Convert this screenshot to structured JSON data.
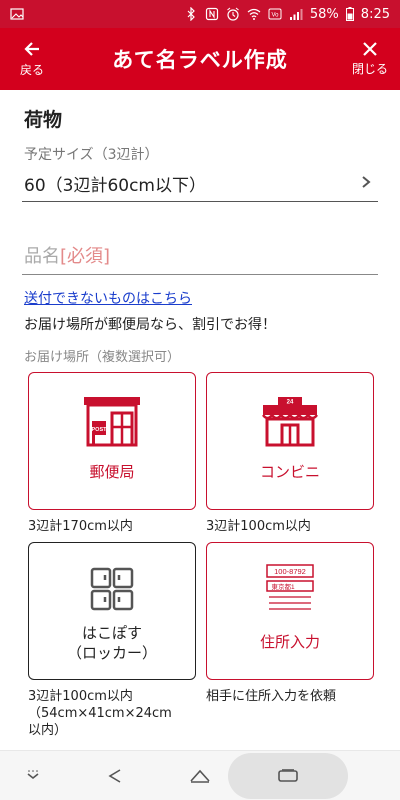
{
  "status_bar": {
    "battery": "58%",
    "time": "8:25",
    "icons": [
      "image-icon",
      "bluetooth-icon",
      "nfc-icon",
      "alarm-icon",
      "wifi-icon",
      "volte-icon",
      "signal-icon",
      "battery-icon"
    ]
  },
  "header": {
    "back_label": "戻る",
    "title": "あて名ラベル作成",
    "close_label": "閉じる",
    "color": "#d3001d"
  },
  "form": {
    "section_title": "荷物",
    "size_label": "予定サイズ（3辺計）",
    "size_value": "60（3辺計60cm以下）",
    "item_name_placeholder": "品名",
    "item_name_required": "[必須]",
    "item_name_value": ""
  },
  "links": {
    "cannot_send": "送付できないものはこちら"
  },
  "notice": "お届け場所が郵便局なら、割引でお得！",
  "destination": {
    "label": "お届け場所（複数選択可）",
    "options": [
      {
        "label": "郵便局",
        "note": "3辺計170cm以内",
        "icon": "post-office-icon",
        "selected": false
      },
      {
        "label": "コンビニ",
        "note": "3辺計100cm以内",
        "icon": "convenience-store-icon",
        "selected": false
      },
      {
        "label_line1": "はこぽす",
        "label_line2": "（ロッカー）",
        "note_line1": "3辺計100cm以内",
        "note_line2": "（54cm×41cm×24cm",
        "note_line3": "以内）",
        "icon": "locker-icon",
        "selected": true
      },
      {
        "label": "住所入力",
        "note": "相手に住所入力を依頼",
        "icon": "address-label-icon",
        "selected": false,
        "icon_text_1": "100-8792",
        "icon_text_2": "東京都1"
      }
    ]
  },
  "accent_color": "#c8102e",
  "navbar": {
    "icons": [
      "keyboard-hide-icon",
      "back-icon",
      "home-icon",
      "recents-icon"
    ]
  }
}
